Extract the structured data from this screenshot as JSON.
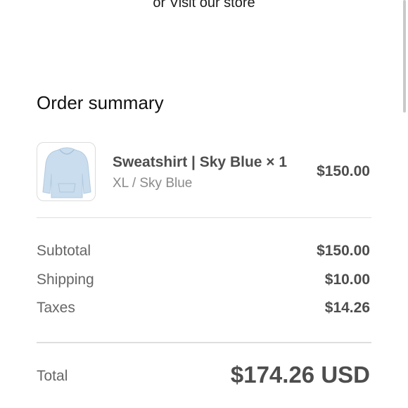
{
  "store_link": "or Visit our store",
  "summary": {
    "title": "Order summary",
    "item": {
      "name": "Sweatshirt | Sky Blue × 1",
      "variant": "XL / Sky Blue",
      "price": "$150.00",
      "image_icon": "hoodie-image",
      "image_color": "#c9ddee"
    },
    "subtotal_label": "Subtotal",
    "subtotal_value": "$150.00",
    "shipping_label": "Shipping",
    "shipping_value": "$10.00",
    "taxes_label": "Taxes",
    "taxes_value": "$14.26",
    "total_label": "Total",
    "total_value": "$174.26 USD"
  }
}
